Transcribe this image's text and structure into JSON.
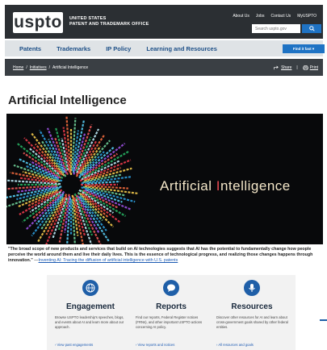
{
  "header": {
    "logo": "uspto",
    "agency_line1": "UNITED STATES",
    "agency_line2": "PATENT AND TRADEMARK OFFICE",
    "links": [
      "About Us",
      "Jobs",
      "Contact Us",
      "MyUSPTO"
    ],
    "search_placeholder": "Search uspto.gov",
    "search_icon": "search-icon"
  },
  "nav": {
    "items": [
      "Patents",
      "Trademarks",
      "IP Policy",
      "Learning and Resources"
    ],
    "find_help": "Find it fast ▾"
  },
  "breadcrumb": {
    "items": [
      "Home",
      "Initiatives",
      "Artificial Intelligence"
    ],
    "share": "Share",
    "print": "Print"
  },
  "page": {
    "title": "Artificial Intelligence",
    "hero_text_a": "Artificial ",
    "hero_text_b": "I",
    "hero_text_c": "ntelligence"
  },
  "quote": {
    "text": "\"The broad scope of new products and services that build on AI technologies suggests that AI has the potential to fundamentally change how people perceive the world around them and live their daily lives. This is the essence of technological progress, and realizing those changes happens through innovation.\"",
    "dash": " —",
    "source": "Inventing AI: Tracing the diffusion of artificial intelligence with U.S. patents"
  },
  "cards": [
    {
      "icon": "globe-icon",
      "title": "Engagement",
      "desc": "Browse USPTO leadership's speeches, blogs, and events about AI and learn more about our approach.",
      "link": "›  View past engagements"
    },
    {
      "icon": "chat-icon",
      "title": "Reports",
      "desc": "Find our reports, Federal Register notices (FRNs), and other important USPTO actions concerning AI policy.",
      "link": "›  View reports and notices"
    },
    {
      "icon": "microphone-icon",
      "title": "Resources",
      "desc": "Discover other resources for AI and learn about cross-government goals shared by other federal entities.",
      "link": "›  All resources and goals"
    }
  ],
  "colors": {
    "header_bg": "#2b2f33",
    "nav_bg": "#dfe3e6",
    "accent_blue": "#1f73c4",
    "link_blue": "#1d5bb3",
    "hero_red": "#e94a53"
  }
}
